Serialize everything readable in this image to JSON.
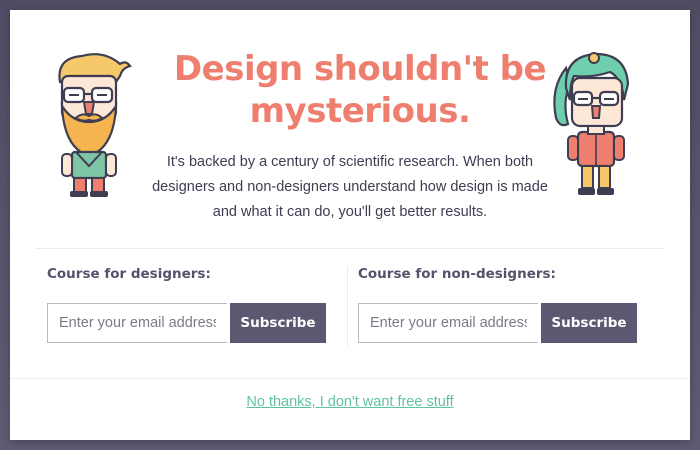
{
  "modal": {
    "headline": "Design shouldn't be mysterious.",
    "subtext": "It's backed by a century of scientific research. When both designers and non-designers understand how design is made and what it can do, you'll get better results."
  },
  "forms": [
    {
      "title": "Course for designers:",
      "email_placeholder": "Enter your email address",
      "email_value": "",
      "subscribe_label": "Subscribe"
    },
    {
      "title": "Course for non-designers:",
      "email_placeholder": "Enter your email address",
      "email_value": "",
      "subscribe_label": "Subscribe"
    }
  ],
  "footer": {
    "decline_label": "No thanks, I don't want free stuff"
  },
  "icons": {
    "left_mascot": "bearded-designer-illustration",
    "right_mascot": "green-haired-designer-illustration"
  },
  "colors": {
    "headline": "#ee7f6e",
    "button": "#5b5972",
    "link": "#5fc3a3",
    "backdrop": "#5c5a72"
  }
}
